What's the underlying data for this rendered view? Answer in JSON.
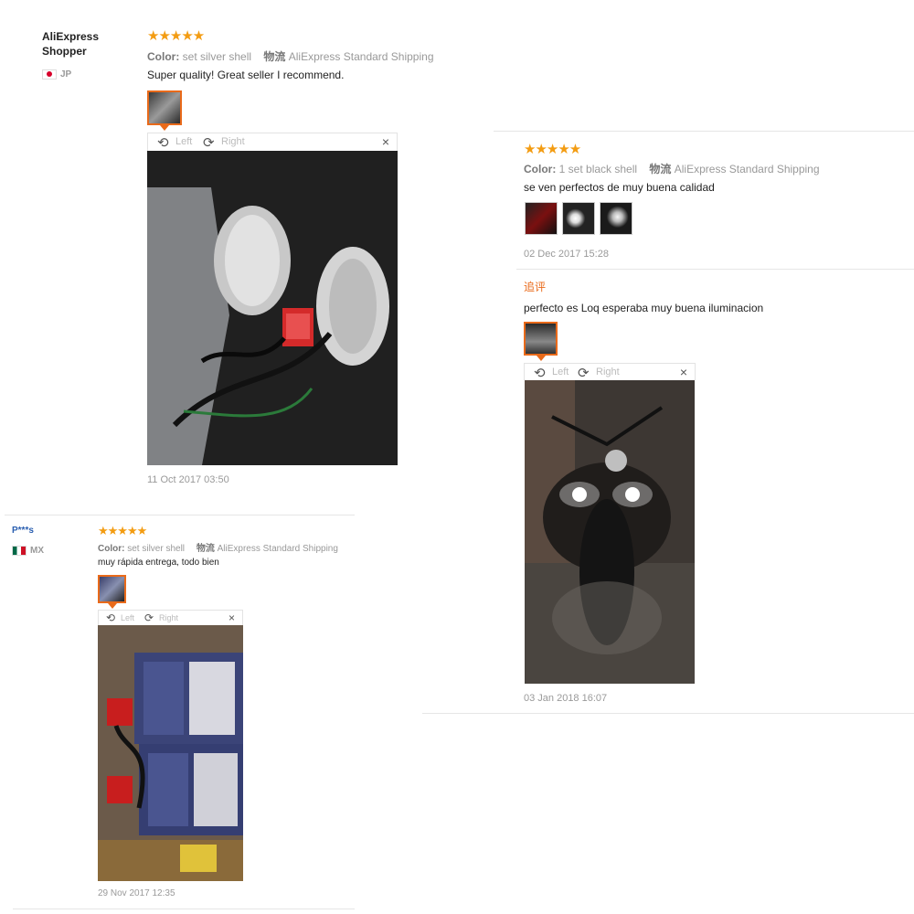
{
  "reviews": [
    {
      "user": "AliExpress Shopper",
      "country": "JP",
      "stars": "★★★★★",
      "color_label": "Color:",
      "color_value": "set silver shell",
      "shipping_label": "物流",
      "shipping_value": "AliExpress Standard Shipping",
      "text": "Super quality! Great seller I recommend.",
      "viewer": {
        "left": "Left",
        "right": "Right",
        "close": "×"
      },
      "date": "11 Oct 2017 03:50"
    },
    {
      "stars": "★★★★★",
      "color_label": "Color:",
      "color_value": "1 set black shell",
      "shipping_label": "物流",
      "shipping_value": "AliExpress Standard Shipping",
      "text": "se ven perfectos de muy buena calidad",
      "date": "02 Dec 2017 15:28",
      "followup_label": "追评",
      "followup_text": "perfecto es Loq esperaba muy buena iluminacion",
      "viewer": {
        "left": "Left",
        "right": "Right",
        "close": "×"
      },
      "followup_date": "03 Jan 2018 16:07"
    },
    {
      "user": "P***s",
      "country": "MX",
      "stars": "★★★★★",
      "color_label": "Color:",
      "color_value": "set silver shell",
      "shipping_label": "物流",
      "shipping_value": "AliExpress Standard Shipping",
      "text": "muy rápida entrega, todo bien",
      "viewer": {
        "left": "Left",
        "right": "Right",
        "close": "×"
      },
      "date": "29 Nov 2017 12:35"
    }
  ],
  "icons": {
    "rotate_left": "rotate-left-icon",
    "rotate_right": "rotate-right-icon",
    "close": "close-icon"
  },
  "colors": {
    "accent": "#e96a1a",
    "star": "#f39c12"
  }
}
